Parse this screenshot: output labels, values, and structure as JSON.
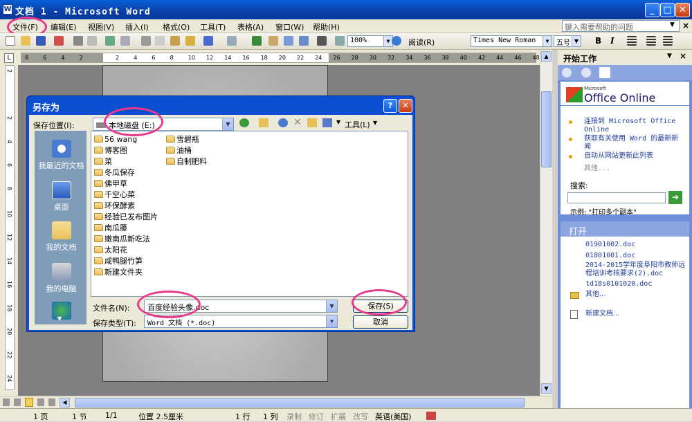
{
  "window": {
    "title": "文档 1 - Microsoft Word",
    "minimize": "_",
    "maximize": "□",
    "close": "✕"
  },
  "menu": [
    "文件(F)",
    "编辑(E)",
    "视图(V)",
    "插入(I)",
    "格式(O)",
    "工具(T)",
    "表格(A)",
    "窗口(W)",
    "帮助(H)"
  ],
  "help_box": {
    "placeholder": "键入需要帮助的问题"
  },
  "toolbar": {
    "zoom": "100%",
    "read_label": "阅读(R)",
    "font": "Times New Roman",
    "size": "五号",
    "bold": "B",
    "italic": "I"
  },
  "ruler_ticks": [
    "8",
    "6",
    "4",
    "2",
    "",
    "2",
    "4",
    "6",
    "8",
    "10",
    "12",
    "14",
    "16",
    "18",
    "20",
    "22",
    "24",
    "26",
    "28",
    "30",
    "32",
    "34",
    "36",
    "38",
    "40",
    "42",
    "44",
    "46",
    "48"
  ],
  "vruler_ticks": [
    "2",
    "",
    "2",
    "4",
    "6",
    "8",
    "10",
    "12",
    "14",
    "16",
    "18",
    "20",
    "22",
    "24"
  ],
  "dialog": {
    "title": "另存为",
    "help": "?",
    "close": "✕",
    "location_label": "保存位置(I):",
    "location_value": "本地磁盘 (E:)",
    "tools_label": "工具(L)",
    "places": [
      "我最近的文档",
      "桌面",
      "我的文档",
      "我的电脑"
    ],
    "folders_col1": [
      "56 wang",
      "博客图",
      "菜",
      "冬瓜保存",
      "佛甲草",
      "千空心菜",
      "环保酵素",
      "经验已发布图片",
      "南瓜藤",
      "嫩南瓜新吃法",
      "太阳花",
      "咸鸭腿竹笋",
      "新建文件夹"
    ],
    "folders_col2": [
      "雪碧瓶",
      "油桶",
      "自制肥料"
    ],
    "filename_label": "文件名(N):",
    "filename_value": "百度经验头像.doc",
    "filetype_label": "保存类型(T):",
    "filetype_value": "Word 文档 (*.doc)",
    "save_button": "保存(S)",
    "cancel_button": "取消"
  },
  "taskpane": {
    "title": "开始工作",
    "brand": "Office Online",
    "brand_small": "Microsoft",
    "links": [
      "连接到 Microsoft Office Online",
      "获取有关使用 Word 的最新新闻",
      "自动从网站更新此列表"
    ],
    "more": "其他...",
    "search_label": "搜索:",
    "example": "示例:  \"打印多个副本\"",
    "open_title": "打开",
    "recent": [
      "01901002.doc",
      "01801001.doc",
      "2014-2015学年度阜阳市教师远程培训考核要求(2).doc",
      "td18s0101020.doc"
    ],
    "open_more": "其他...",
    "new_doc": "新建文档..."
  },
  "status": {
    "page": "1 页",
    "section": "1 节",
    "pages": "1/1",
    "position": "位置 2.5厘米",
    "line": "1 行",
    "col": "1 列",
    "rec": "录制",
    "trk": "修订",
    "ext": "扩展",
    "ovr": "改写",
    "lang": "英语(美国)"
  },
  "colors": {
    "highlight": "#e83a8c",
    "xp_blue": "#0b4fd0",
    "taskpane_blue": "#6b8ed6"
  }
}
